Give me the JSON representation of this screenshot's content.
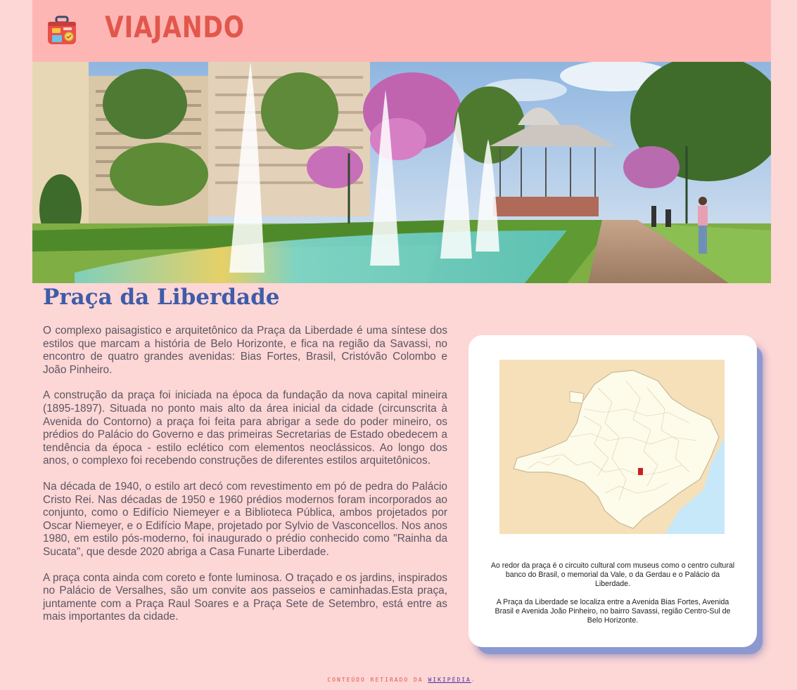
{
  "header": {
    "brand": "VIAJANDO",
    "logo_icon": "suitcase-icon"
  },
  "hero": {
    "image": "praca-da-liberdade-photo"
  },
  "article": {
    "title": "Praça da Liberdade",
    "paragraphs": [
      "O complexo paisagistico e arquitetônico da Praça da Liberdade é uma síntese dos estilos que marcam a história de Belo Horizonte, e fica na região da Savassi, no encontro de quatro grandes avenidas: Bias Fortes, Brasil, Cristóvão Colombo e João Pinheiro.",
      "A construção da praça foi iniciada na época da fundação da nova capital mineira (1895-1897). Situada no ponto mais alto da área inicial da cidade (circunscrita à Avenida do Contorno) a praça foi feita para abrigar a sede do poder mineiro, os prédios do Palácio do Governo e das primeiras Secretarias de Estado obedecem a tendência da época - estilo eclético com elementos neoclássicos. Ao longo dos anos, o complexo foi recebendo construções de diferentes estilos arquitetônicos.",
      "Na década de 1940, o estilo art decó com revestimento em pó de pedra do Palácio Cristo Rei. Nas décadas de 1950 e 1960 prédios modernos foram incorporados ao conjunto, como o Edifício Niemeyer e a Biblioteca Pública, ambos projetados por Oscar Niemeyer, e o Edifício Mape, projetado por Sylvio de Vasconcellos. Nos anos 1980, em estilo pós-moderno, foi inaugurado o prédio conhecido como \"Rainha da Sucata\", que desde 2020 abriga a Casa Funarte Liberdade.",
      "A praça conta ainda com coreto e fonte luminosa. O traçado e os jardins, inspirados no Palácio de Versalhes, são um convite aos passeios e caminhadas.Esta praça, juntamente com a Praça Raul Soares e a Praça Sete de Setembro, está entre as mais importantes da cidade."
    ]
  },
  "sidebar": {
    "map_image": "minas-gerais-map",
    "captions": [
      "Ao redor da praça é o circuito cultural com museus como o centro cultural banco do Brasil, o memorial da Vale, o da Gerdau e o Palácio da Liberdade.",
      "A Praça da Liberdade se localiza entre a Avenida Bias Fortes, Avenida Brasil e Avenida João Pinheiro, no bairro Savassi, região Centro-Sul de Belo Horizonte."
    ]
  },
  "footer": {
    "text": "CONTEÚDO RETIRADO DA ",
    "link_label": "WIKIPÉDIA",
    "suffix": "."
  },
  "colors": {
    "background": "#fdd6d6",
    "header": "#feb6b4",
    "brand": "#e2574c",
    "title": "#3f5ca8",
    "text": "#5b5660",
    "card_shadow": "#8c98d0"
  }
}
